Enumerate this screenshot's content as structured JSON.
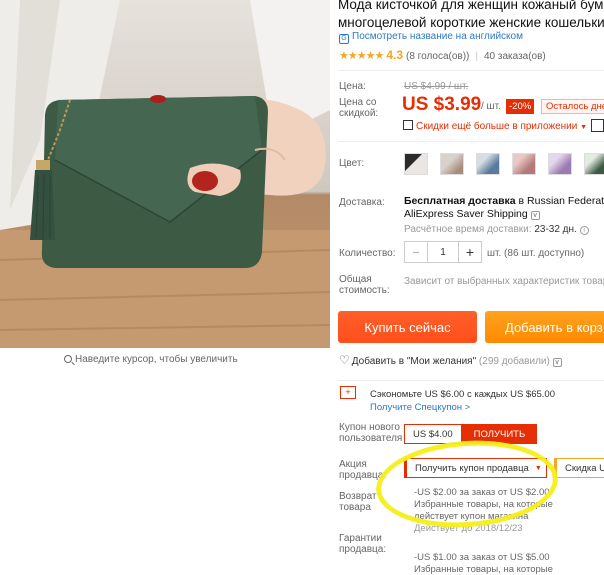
{
  "product": {
    "title_line1": "Мода кисточкой для женщин кожаный бумажни",
    "title_line2": "многоцелевой короткие женские кошельки изме",
    "translate_link": "Посмотреть название на английском",
    "rating": {
      "stars": "★★★★★",
      "score": "4.3",
      "votes": "(8 голоса(ов))",
      "orders": "40 заказа(ов)"
    }
  },
  "gallery": {
    "zoom_hint": "Наведите курсор, чтобы увеличить"
  },
  "price": {
    "label": "Цена:",
    "old": "US $4.99 / шт.",
    "discount_label_line1": "Цена со",
    "discount_label_line2": "скидкой:",
    "current": "US $3.99",
    "unit": "/ шт.",
    "discount": "-20%",
    "time_left": "Осталось дне",
    "app_promo": "Скидки ещё больше в приложении"
  },
  "color": {
    "label": "Цвет:",
    "swatches": [
      "black",
      "beige",
      "blue",
      "pink",
      "purple",
      "green"
    ]
  },
  "shipping": {
    "label": "Доставка:",
    "main_bold": "Бесплатная доставка",
    "main_rest": "в Russian Federation",
    "method": "AliExpress Saver Shipping",
    "time_label": "Расчётное время доставки:",
    "time_value": "23-32 дн."
  },
  "quantity": {
    "label": "Количество:",
    "minus": "−",
    "value": "1",
    "plus": "+",
    "available": "шт. (86 шт. доступно)"
  },
  "total": {
    "label_line1": "Общая",
    "label_line2": "стоимость:",
    "note": "Зависит от выбранных характеристик товар"
  },
  "actions": {
    "buy_now": "Купить сейчас",
    "add_to_cart": "Добавить в корз"
  },
  "wishlist": {
    "label": "Добавить в \"Мои желания\"",
    "count": "(299 добавили)"
  },
  "promo": {
    "save_text": "Сэкономьте US $6.00 с каждых US $65.00",
    "save_link": "Получите Спецкупон >",
    "new_user_label_line1": "Купон нового",
    "new_user_label_line2": "пользователя",
    "coupon_amount": "US $4.00",
    "coupon_get": "ПОЛУЧИТЬ",
    "seller_label_line1": "Акция",
    "seller_label_line2": "продавца:",
    "seller_select": "Получить купон продавца",
    "seller_select2": "Скидка U",
    "return_label_line1": "Возврат",
    "return_label_line2": "товара",
    "guarantee_label_line1": "Гарантии",
    "guarantee_label_line2": "продавца:",
    "deal1_line1": "-US $2.00 за заказ от US $2.00",
    "deal1_line2": "Избранные товары, на которые",
    "deal1_line3": "действует купон магазина",
    "deal1_valid": "Действует до 2018/12/23",
    "deal2_line1": "-US $1.00 за заказ от US $5.00",
    "deal2_line2": "Избранные товары, на которые"
  },
  "colors": {
    "accent_red": "#e62e04",
    "link_blue": "#2d7ac9",
    "buy_orange": "#ff4f1a",
    "cart_orange": "#ff9711",
    "highlight_yellow": "#f7ee1a",
    "wallet_green": "#3d5a45"
  }
}
